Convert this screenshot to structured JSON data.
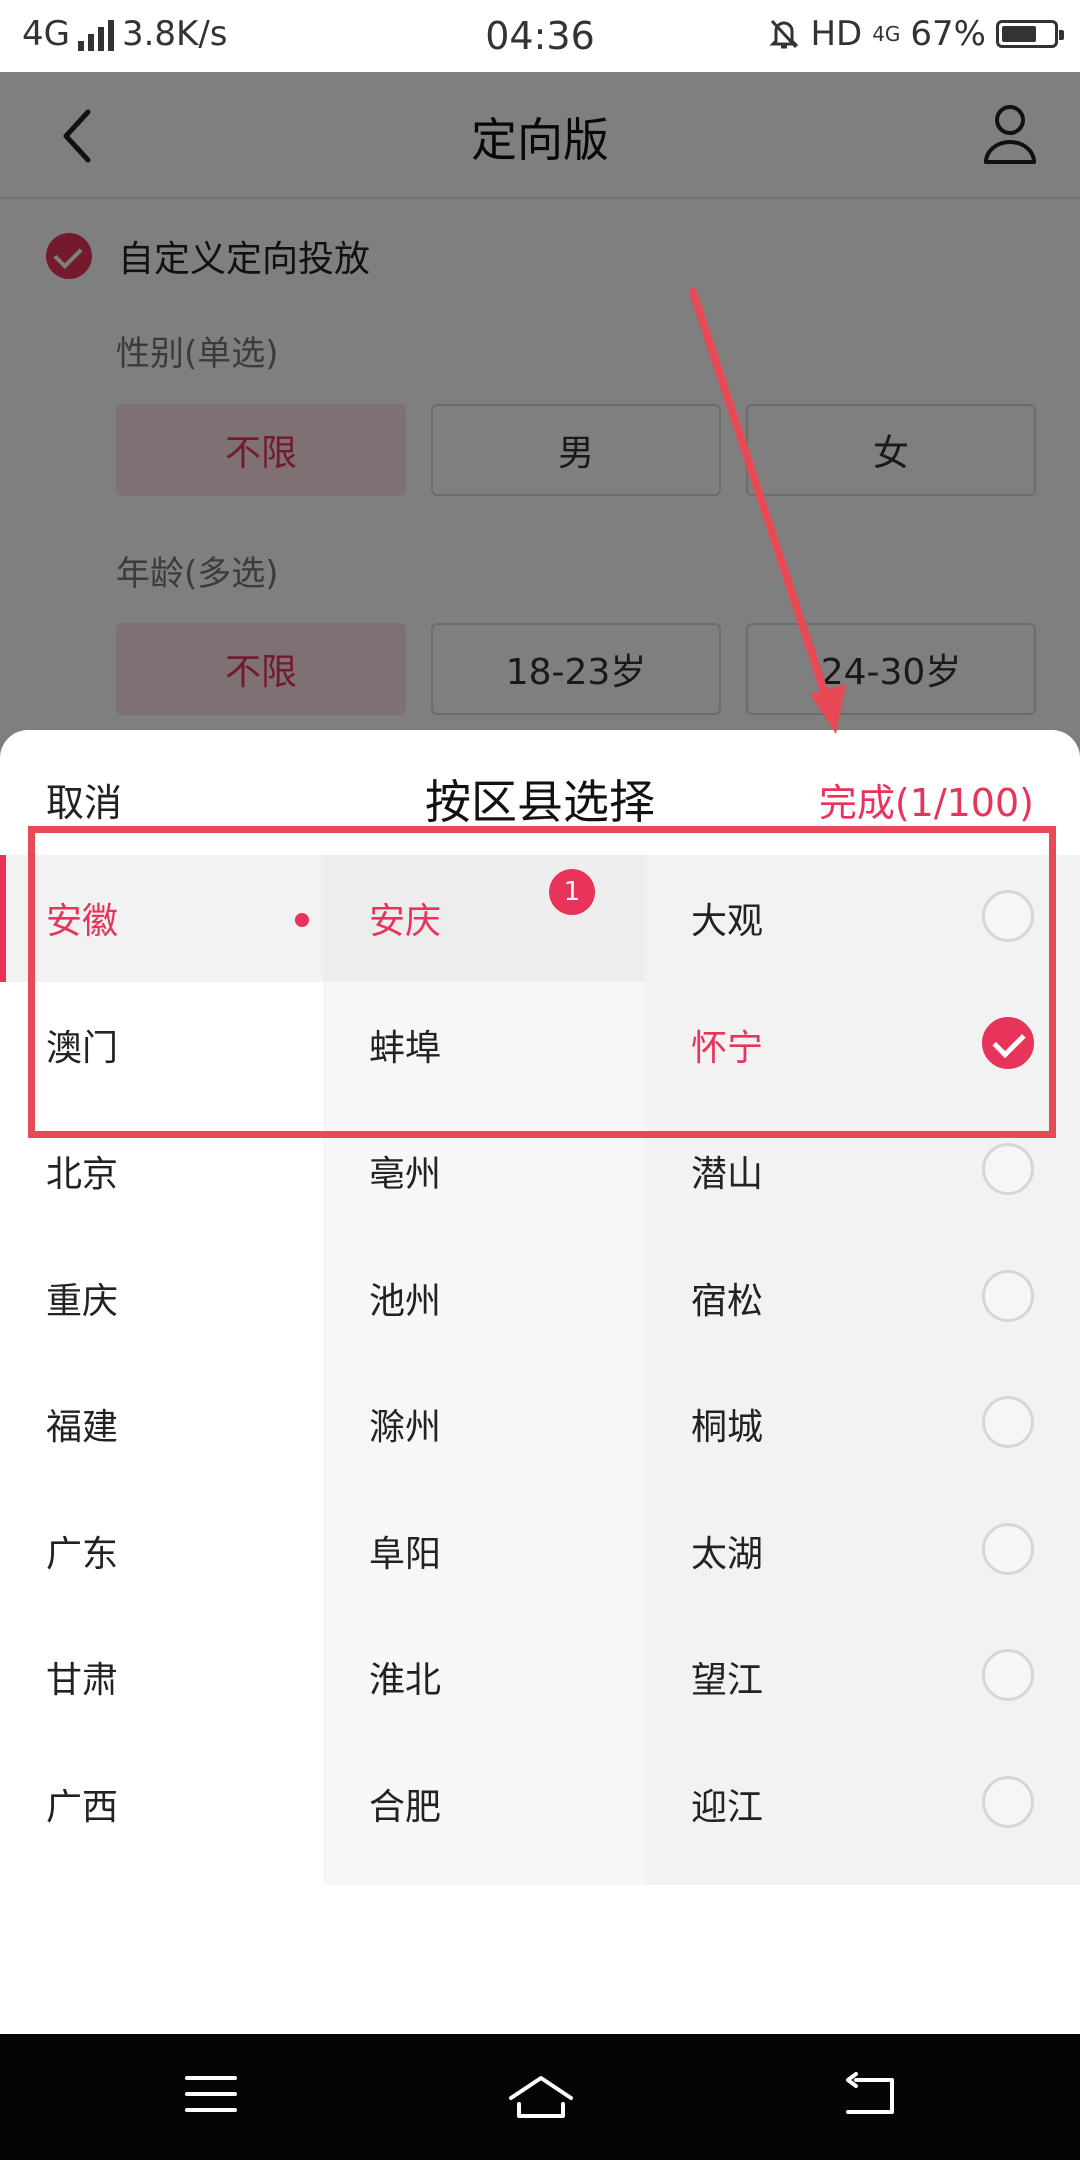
{
  "status_bar": {
    "network": "4G",
    "speed": "3.8K/s",
    "time": "04:36",
    "hd": "HD",
    "net2": "4G",
    "battery_pct": "67%",
    "battery_level": 0.67
  },
  "app": {
    "title": "定向版",
    "custom_label": "自定义定向投放",
    "gender_label": "性别(单选)",
    "gender_options": [
      "不限",
      "男",
      "女"
    ],
    "age_label": "年龄(多选)",
    "age_options": [
      "不限",
      "18-23岁",
      "24-30岁"
    ]
  },
  "sheet": {
    "cancel": "取消",
    "title": "按区县选择",
    "done": "完成(1/100)",
    "provinces": [
      "安徽",
      "澳门",
      "北京",
      "重庆",
      "福建",
      "广东",
      "甘肃",
      "广西"
    ],
    "cities": [
      "安庆",
      "蚌埠",
      "亳州",
      "池州",
      "滁州",
      "阜阳",
      "淮北",
      "合肥"
    ],
    "city_badge": "1",
    "districts": [
      "大观",
      "怀宁",
      "潜山",
      "宿松",
      "桐城",
      "太湖",
      "望江",
      "迎江"
    ],
    "selected_province": "安徽",
    "selected_city": "安庆",
    "checked_district": "怀宁"
  },
  "colors": {
    "accent": "#e8345a",
    "annotation": "#e84a55"
  }
}
